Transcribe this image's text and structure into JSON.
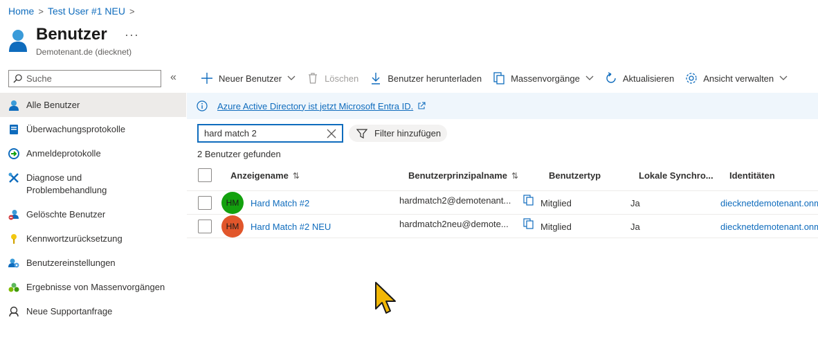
{
  "breadcrumb": {
    "home": "Home",
    "user": "Test User #1 NEU"
  },
  "header": {
    "title": "Benutzer",
    "more": "···",
    "subtitle": "Demotenant.de (diecknet)"
  },
  "sidebar": {
    "search_placeholder": "Suche",
    "collapse": "«",
    "items": [
      {
        "label": "Alle Benutzer",
        "icon": "user-icon",
        "active": true
      },
      {
        "label": "Überwachungsprotokolle",
        "icon": "audit-log-icon"
      },
      {
        "label": "Anmeldeprotokolle",
        "icon": "signin-log-icon"
      },
      {
        "label": "Diagnose und Problembehandlung",
        "icon": "wrench-icon"
      },
      {
        "label": "Gelöschte Benutzer",
        "icon": "deleted-user-icon"
      },
      {
        "label": "Kennwortzurücksetzung",
        "icon": "key-icon"
      },
      {
        "label": "Benutzereinstellungen",
        "icon": "user-settings-icon"
      },
      {
        "label": "Ergebnisse von Massenvorgängen",
        "icon": "bulk-results-icon"
      },
      {
        "label": "Neue Supportanfrage",
        "icon": "support-icon"
      }
    ]
  },
  "toolbar": {
    "new_user": "Neuer Benutzer",
    "delete": "Löschen",
    "download": "Benutzer herunterladen",
    "bulk": "Massenvorgänge",
    "refresh": "Aktualisieren",
    "manage_view": "Ansicht verwalten"
  },
  "banner": {
    "text": "Azure Active Directory ist jetzt Microsoft Entra ID."
  },
  "filter": {
    "value": "hard match 2",
    "add_filter": "Filter hinzufügen"
  },
  "result_count": "2 Benutzer gefunden",
  "table": {
    "headers": {
      "display_name": "Anzeigename",
      "upn": "Benutzerprinzipalname",
      "user_type": "Benutzertyp",
      "sync": "Lokale Synchro...",
      "identities": "Identitäten"
    },
    "rows": [
      {
        "initials": "HM",
        "avatar_color": "#13a10e",
        "name": "Hard Match #2",
        "upn": "hardmatch2@demotenant...",
        "type": "Mitglied",
        "sync": "Ja",
        "identity": "diecknetdemotenant.onm"
      },
      {
        "initials": "HM",
        "avatar_color": "#e1562b",
        "name": "Hard Match #2 NEU",
        "upn": "hardmatch2neu@demote...",
        "type": "Mitglied",
        "sync": "Ja",
        "identity": "diecknetdemotenant.onm"
      }
    ]
  },
  "colors": {
    "accent": "#0f6cbd",
    "banner_bg": "#eff6fc",
    "active_nav": "#edebe9"
  }
}
